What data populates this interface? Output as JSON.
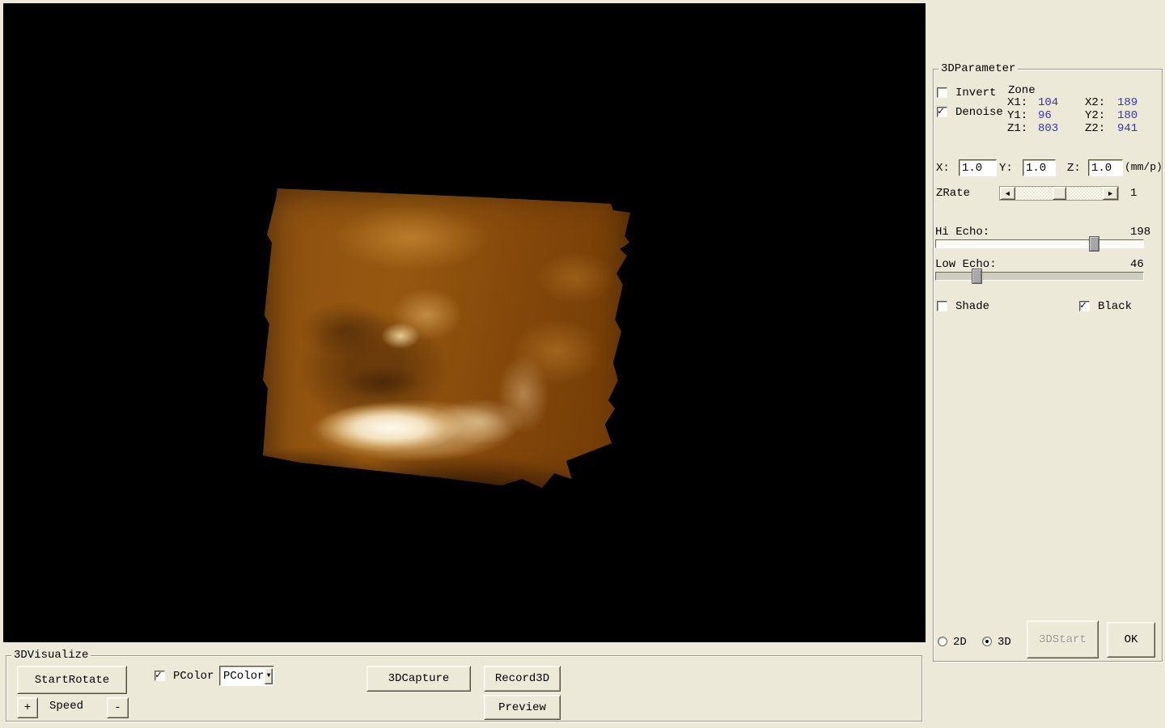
{
  "colors": {
    "background": "#ece9d8",
    "viewport": "#000000",
    "value_text": "#3333cc",
    "volume_base": "#8d5010"
  },
  "param_panel": {
    "title": "3DParameter",
    "invert": {
      "label": "Invert",
      "checked": false
    },
    "denoise": {
      "label": "Denoise",
      "checked": true
    },
    "zone": {
      "title": "Zone",
      "x1_label": "X1:",
      "x1": "104",
      "x2_label": "X2:",
      "x2": "189",
      "y1_label": "Y1:",
      "y1": "96",
      "y2_label": "Y2:",
      "y2": "180",
      "z1_label": "Z1:",
      "z1": "803",
      "z2_label": "Z2:",
      "z2": "941"
    },
    "scale": {
      "x_label": "X:",
      "x_value": "1.0",
      "y_label": "Y:",
      "y_value": "1.0",
      "z_label": "Z:",
      "z_value": "1.0",
      "unit": "(mm/p)"
    },
    "zrate": {
      "label": "ZRate",
      "value": "1"
    },
    "hi_echo": {
      "label": "Hi Echo:",
      "value": "198",
      "max": 255
    },
    "low_echo": {
      "label": "Low Echo:",
      "value": "46",
      "max": 255
    },
    "shade": {
      "label": "Shade",
      "checked": false
    },
    "black": {
      "label": "Black",
      "checked": true
    },
    "mode": {
      "radio_2d": {
        "label": "2D",
        "selected": false
      },
      "radio_3d": {
        "label": "3D",
        "selected": true
      }
    },
    "buttons": {
      "start3d": {
        "label": "3DStart",
        "enabled": false
      },
      "ok": {
        "label": "OK",
        "enabled": true
      }
    }
  },
  "visualize_panel": {
    "title": "3DVisualize",
    "start_rotate_label": "StartRotate",
    "pcolor": {
      "label": "PColor",
      "checked": true
    },
    "pcolor_dropdown": {
      "value": "PColor"
    },
    "speed": {
      "plus": "+",
      "label": "Speed",
      "minus": "-"
    },
    "capture_label": "3DCapture",
    "record_label": "Record3D",
    "preview_label": "Preview"
  }
}
